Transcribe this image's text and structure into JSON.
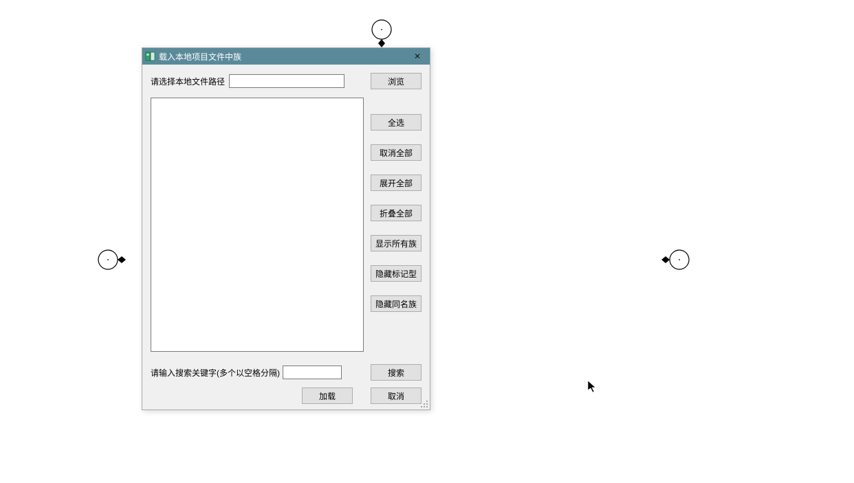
{
  "dialog": {
    "title": "载入本地项目文件中族",
    "close_symbol": "✕"
  },
  "row1": {
    "label": "请选择本地文件路径",
    "path_value": "",
    "browse": "浏览"
  },
  "side": {
    "select_all": "全选",
    "deselect_all": "取消全部",
    "expand_all": "展开全部",
    "collapse_all": "折叠全部",
    "show_all_families": "显示所有族",
    "hide_marker_types": "隐藏标记型",
    "hide_same_name_families": "隐藏同名族"
  },
  "search": {
    "label": "请输入搜索关键字(多个以空格分隔)",
    "value": "",
    "button": "搜索"
  },
  "bottom": {
    "load": "加载",
    "cancel": "取消"
  }
}
